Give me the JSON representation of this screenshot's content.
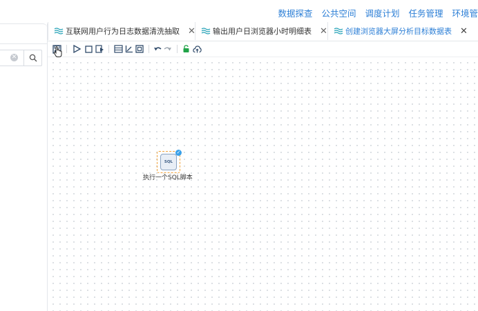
{
  "topnav": {
    "links": [
      "数据探查",
      "公共空间",
      "调度计划",
      "任务管理",
      "环境管"
    ]
  },
  "tabs": [
    {
      "label": "互联网用户行为日志数据清洗抽取",
      "close": "✕",
      "active": false
    },
    {
      "label": "输出用户日浏览器小时明细表",
      "close": "✕",
      "active": false
    },
    {
      "label": "创建浏览器大屏分析目标数据表",
      "close": "✕",
      "active": true
    }
  ],
  "search": {
    "placeholder": "",
    "clear_symbol": "✕"
  },
  "node": {
    "label": "执行一个SQL脚本",
    "icon_text": "SQL",
    "status_symbol": "✓"
  },
  "colors": {
    "accent": "#2d7fd6",
    "node_border": "#f0a23a",
    "lock_green": "#21a348"
  }
}
